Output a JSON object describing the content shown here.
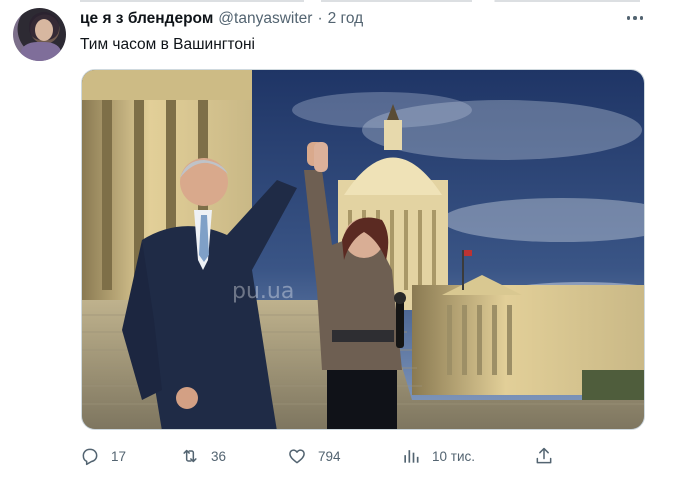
{
  "tweet": {
    "author": {
      "display_name": "це я з блендером",
      "handle": "@tanyaswiter",
      "separator": "·",
      "time": "2 год"
    },
    "text": "Тим часом в Вашингтоні",
    "media": {
      "watermark": "pu.ua"
    }
  },
  "actions": {
    "reply": {
      "icon": "reply-icon",
      "count": "17"
    },
    "retweet": {
      "icon": "retweet-icon",
      "count": "36"
    },
    "like": {
      "icon": "heart-icon",
      "count": "794"
    },
    "views": {
      "icon": "bar-chart-icon",
      "count": "10 тис."
    },
    "share": {
      "icon": "share-icon"
    },
    "more": {
      "icon": "more-icon"
    }
  },
  "colors": {
    "text_primary": "#0f1419",
    "text_secondary": "#536471",
    "sky": "#2a3f6c",
    "stone": "#d8c89a"
  }
}
